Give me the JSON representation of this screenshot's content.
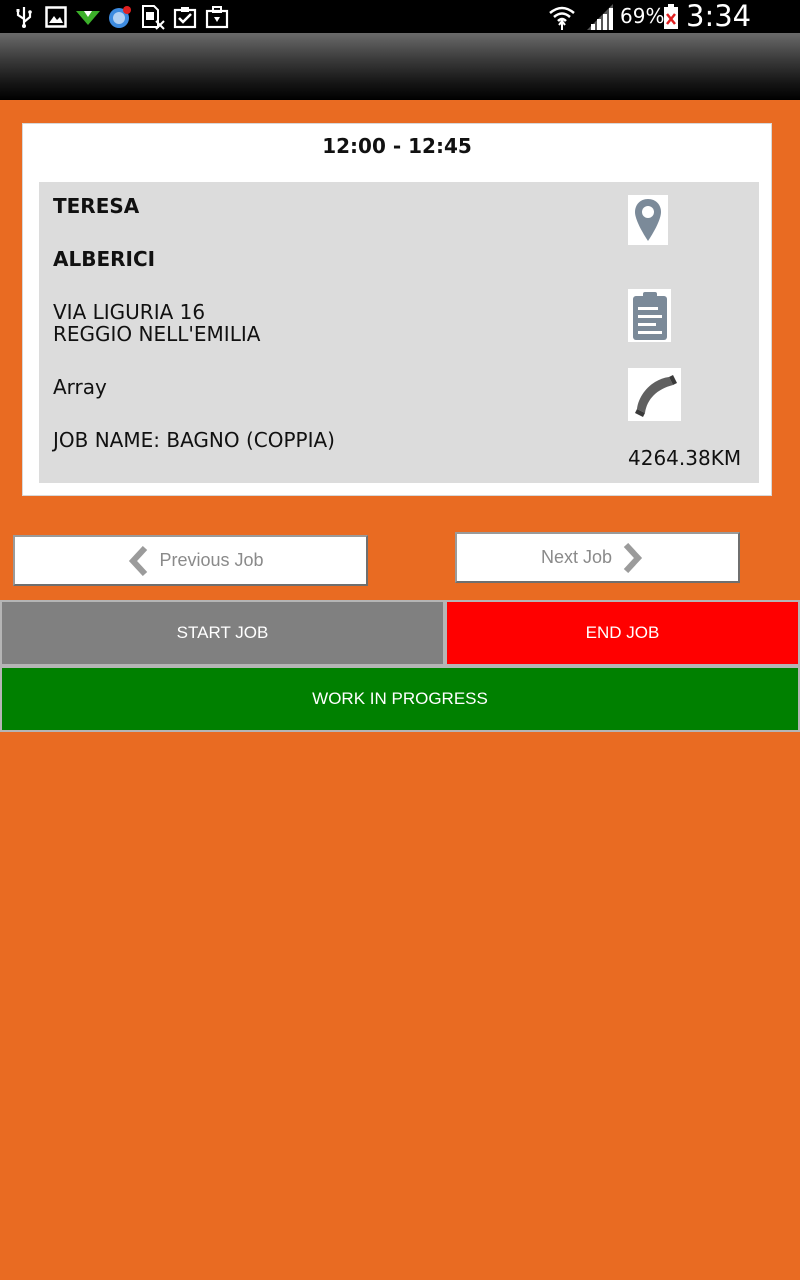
{
  "status_bar": {
    "battery_percent": "69%",
    "time": "3:34 PM",
    "icons": [
      "usb-icon",
      "gallery-icon",
      "download-icon",
      "browser-notification-icon",
      "sim-card-icon",
      "clipboard-check-icon",
      "briefcase-icon",
      "wifi-icon",
      "signal-icon",
      "battery-icon"
    ]
  },
  "job": {
    "time_range": "12:00 - 12:45",
    "first_name": "TERESA",
    "last_name": "ALBERICI",
    "address_line1": "VIA LIGURIA 16",
    "address_line2": "REGGIO NELL'EMILIA",
    "phone": "Array",
    "job_name": "JOB NAME: BAGNO (COPPIA)",
    "distance": "4264.38KM"
  },
  "nav": {
    "previous_label": "Previous Job",
    "next_label": "Next Job"
  },
  "actions": {
    "start_label": "START JOB",
    "end_label": "END JOB",
    "progress_label": "WORK IN PROGRESS"
  },
  "colors": {
    "background": "#e96b22",
    "start_button": "#808080",
    "end_button": "#ff0000",
    "progress_button": "#008000",
    "icon_gray": "#7b8a99"
  }
}
